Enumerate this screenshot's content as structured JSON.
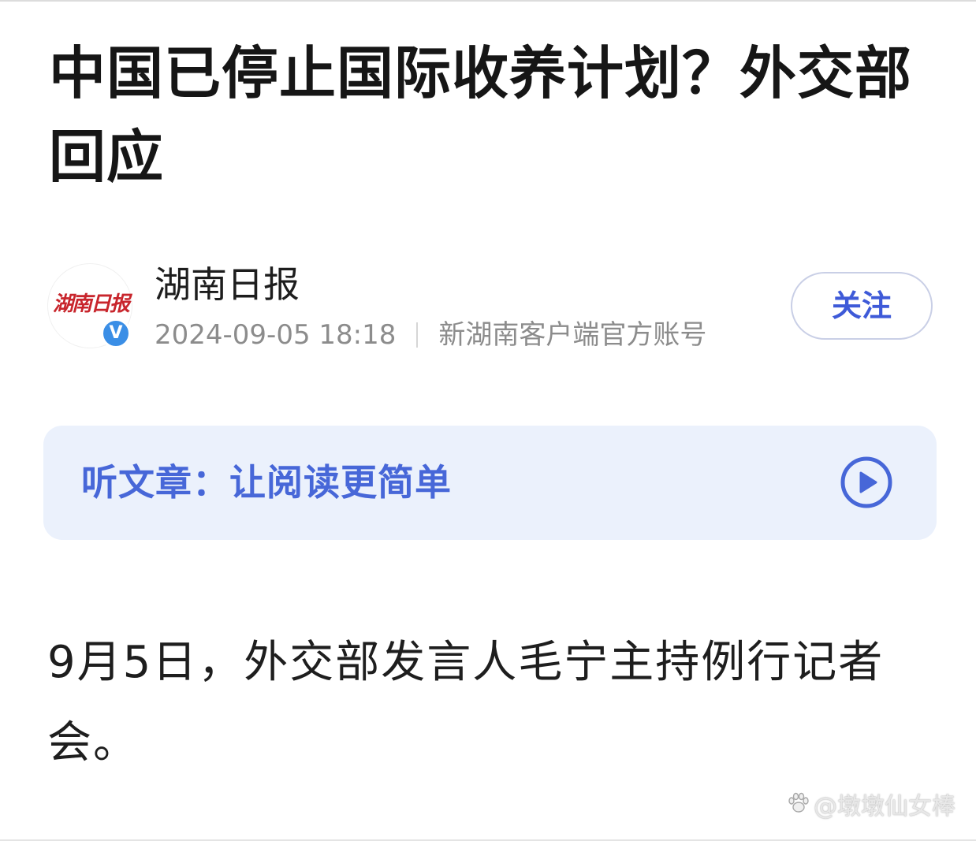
{
  "article": {
    "title": "中国已停止国际收养计划？外交部回应",
    "body": "9月5日，外交部发言人毛宁主持例行记者会。"
  },
  "author": {
    "name": "湖南日报",
    "logo_text": "湖南日报",
    "verified_mark": "V",
    "publish_time": "2024-09-05 18:18",
    "account_desc": "新湖南客户端官方账号"
  },
  "follow_button": {
    "label": "关注"
  },
  "listen": {
    "label": "听文章：让阅读更简单",
    "icon": "play-circle-icon"
  },
  "watermark": {
    "text": "@墩墩仙女棒",
    "icon": "paw-icon"
  },
  "colors": {
    "accent": "#4767d8",
    "listen_bg": "#ebf1fc",
    "verified": "#3a8ee6",
    "logo_red": "#c8252c"
  }
}
